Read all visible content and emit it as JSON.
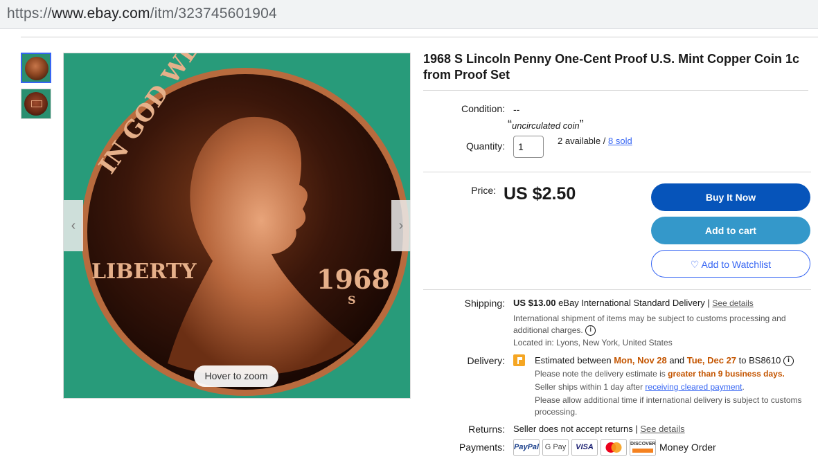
{
  "browser": {
    "url_scheme": "https://",
    "url_host": "www.ebay.com",
    "url_path": "/itm/323745601904"
  },
  "gallery": {
    "thumbnails": [
      "coin-obverse",
      "coin-reverse"
    ],
    "zoom_hint": "Hover to zoom",
    "prev_arrow": "‹",
    "next_arrow": "›"
  },
  "listing": {
    "title": "1968 S Lincoln Penny One-Cent Proof U.S. Mint Copper Coin 1c from Proof Set",
    "condition_label": "Condition:",
    "condition_value": "--",
    "condition_quote": "uncirculated coin",
    "quantity_label": "Quantity:",
    "quantity_value": "1",
    "available_text": "2 available",
    "sold_link": "8 sold",
    "price_label": "Price:",
    "price_value": "US $2.50"
  },
  "actions": {
    "buy_now": "Buy It Now",
    "add_to_cart": "Add to cart",
    "watchlist": "♡ Add to Watchlist"
  },
  "shipping": {
    "label": "Shipping:",
    "cost": "US $13.00",
    "method": "eBay International Standard Delivery",
    "details_link": "See details",
    "customs_note": "International shipment of items may be subject to customs processing and additional charges.",
    "location": "Located in: Lyons, New York, United States"
  },
  "delivery": {
    "label": "Delivery:",
    "estimated_prefix": "Estimated between",
    "date_from": "Mon, Nov 28",
    "and_word": "and",
    "date_to": "Tue, Dec 27",
    "to_postcode": "to BS8610",
    "note_prefix": "Please note the delivery estimate is",
    "note_emphasis": "greater than 9 business days.",
    "ships_prefix": "Seller ships within 1 day after",
    "ships_link": "receiving cleared payment",
    "allow_note": "Please allow additional time if international delivery is subject to customs processing."
  },
  "returns": {
    "label": "Returns:",
    "text": "Seller does not accept returns",
    "details_link": "See details"
  },
  "payments": {
    "label": "Payments:",
    "methods": [
      "PayPal",
      "G Pay",
      "VISA",
      "Mastercard",
      "DISCOVER"
    ],
    "extra": "Money Order"
  },
  "colors": {
    "buy_now": "#0654ba",
    "add_to_cart": "#3498ca",
    "link": "#3665f3",
    "orange": "#c45500",
    "image_background": "#289b7a"
  }
}
